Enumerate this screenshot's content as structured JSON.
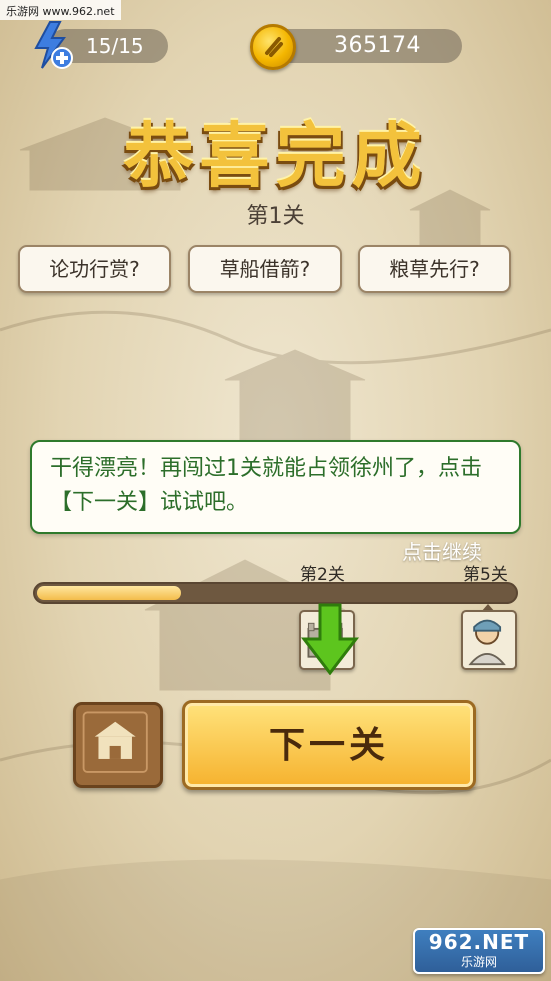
{
  "watermark_top": "乐游网 www.962.net",
  "energy": {
    "value": "15/15",
    "icon": "lightning-plus-icon"
  },
  "coins": {
    "value": "365174",
    "icon": "gold-coin-icon"
  },
  "title": "恭喜完成",
  "level_label": "第1关",
  "questions": [
    "论功行赏?",
    "草船借箭?",
    "粮草先行?"
  ],
  "dialog_text": "干得漂亮！再闯过1关就能占领徐州了，点击【下一关】试试吧。",
  "continue_label": "点击继续",
  "progress": {
    "fraction": 0.3,
    "level_2_label": "第2关",
    "level_5_label": "第5关"
  },
  "next_button_label": "下一关",
  "watermark_bottom": {
    "number": "962.NET",
    "site": "乐游网"
  },
  "colors": {
    "title_gold": "#f3c23c",
    "dialog_green": "#2c6e2a",
    "progress_fill": "#f3bc4b"
  }
}
